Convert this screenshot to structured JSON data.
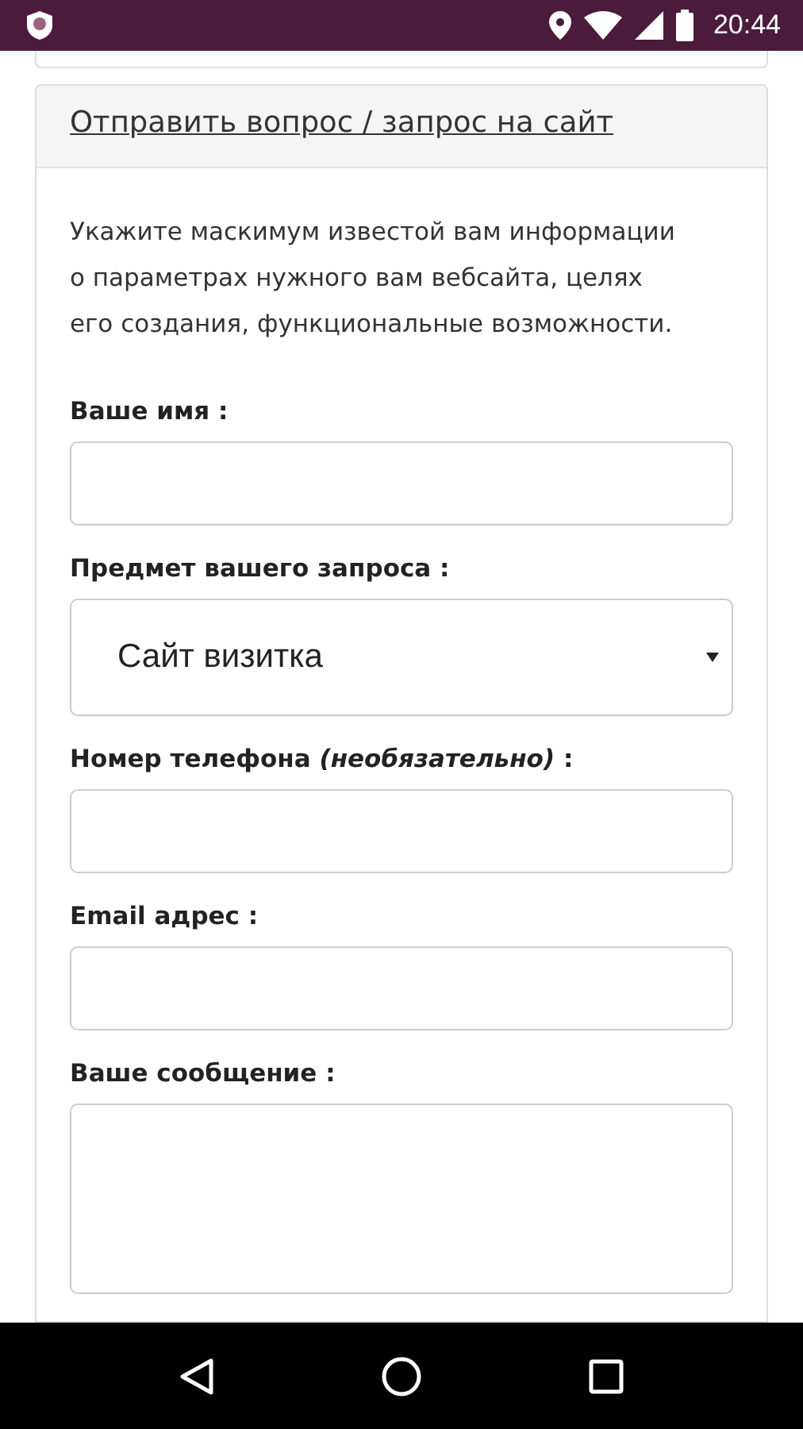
{
  "status_bar": {
    "time": "20:44"
  },
  "card": {
    "title": "Отправить вопрос / запрос на сайт",
    "intro": "Укажите маскимум известой вам информации о параметрах нужного вам вебсайта, целях его создания, функциональные возможности.",
    "fields": [
      {
        "kind": "text",
        "label": "Ваше имя :"
      },
      {
        "kind": "select",
        "label": "Предмет вашего запроса :",
        "value": "Сайт визитка"
      },
      {
        "kind": "text",
        "label": "Номер телефона *(необязательно)* :"
      },
      {
        "kind": "text",
        "label": "Email адрес :"
      },
      {
        "kind": "textarea",
        "label": "Ваше сообщение :"
      }
    ]
  }
}
